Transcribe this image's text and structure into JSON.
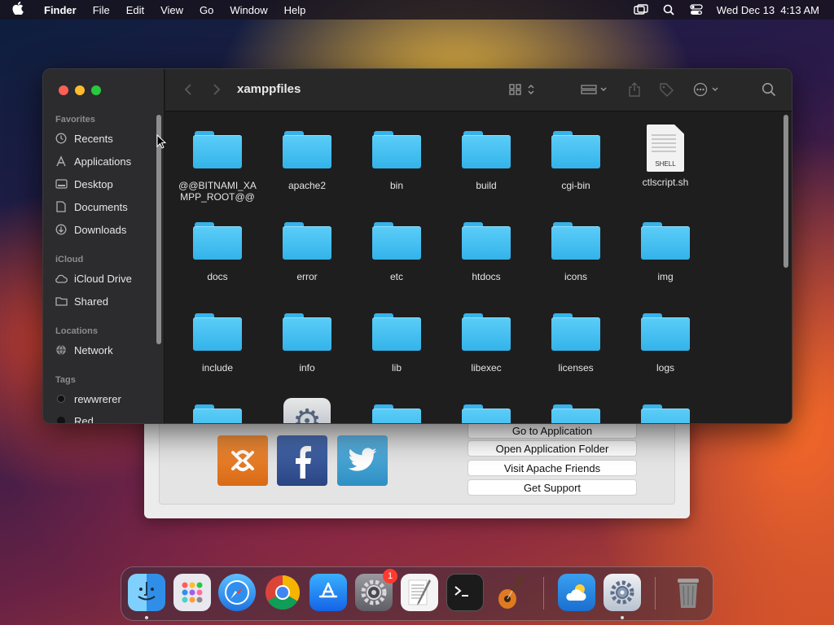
{
  "menubar": {
    "app_name": "Finder",
    "items": [
      "File",
      "Edit",
      "View",
      "Go",
      "Window",
      "Help"
    ],
    "datetime": "Wed Dec 13  4:13 AM"
  },
  "finder": {
    "title": "xamppfiles",
    "sidebar": {
      "favorites_header": "Favorites",
      "favorites": [
        {
          "label": "Recents",
          "icon": "clock-icon"
        },
        {
          "label": "Applications",
          "icon": "applications-icon"
        },
        {
          "label": "Desktop",
          "icon": "desktop-icon"
        },
        {
          "label": "Documents",
          "icon": "document-icon"
        },
        {
          "label": "Downloads",
          "icon": "download-icon"
        }
      ],
      "icloud_header": "iCloud",
      "icloud": [
        {
          "label": "iCloud Drive",
          "icon": "cloud-icon"
        },
        {
          "label": "Shared",
          "icon": "shared-folder-icon"
        }
      ],
      "locations_header": "Locations",
      "locations": [
        {
          "label": "Network",
          "icon": "globe-icon"
        }
      ],
      "tags_header": "Tags",
      "tags": [
        {
          "label": "rewwrerer",
          "color": "#1a1a1a"
        },
        {
          "label": "Red",
          "color": "#ff453a"
        }
      ]
    },
    "items": [
      {
        "label": "@@BITNAMI_XAMPP_ROOT@@",
        "kind": "folder"
      },
      {
        "label": "apache2",
        "kind": "folder"
      },
      {
        "label": "bin",
        "kind": "folder"
      },
      {
        "label": "build",
        "kind": "folder"
      },
      {
        "label": "cgi-bin",
        "kind": "folder"
      },
      {
        "label": "ctlscript.sh",
        "kind": "shell",
        "badge": "SHELL"
      },
      {
        "label": "docs",
        "kind": "folder"
      },
      {
        "label": "error",
        "kind": "folder"
      },
      {
        "label": "etc",
        "kind": "folder"
      },
      {
        "label": "htdocs",
        "kind": "folder"
      },
      {
        "label": "icons",
        "kind": "folder"
      },
      {
        "label": "img",
        "kind": "folder"
      },
      {
        "label": "include",
        "kind": "folder"
      },
      {
        "label": "info",
        "kind": "folder"
      },
      {
        "label": "lib",
        "kind": "folder"
      },
      {
        "label": "libexec",
        "kind": "folder"
      },
      {
        "label": "licenses",
        "kind": "folder"
      },
      {
        "label": "logs",
        "kind": "folder"
      }
    ]
  },
  "xampp": {
    "buttons": [
      "Go to Application",
      "Open Application Folder",
      "Visit Apache Friends",
      "Get Support"
    ]
  },
  "dock": {
    "apps": [
      {
        "name": "finder-icon",
        "color": "#3aa0f0"
      },
      {
        "name": "launchpad-icon",
        "color": "#e8e8ee"
      },
      {
        "name": "safari-icon",
        "color": "#2f8ff0"
      },
      {
        "name": "chrome-icon",
        "color": "#ffffff"
      },
      {
        "name": "app-store-icon",
        "color": "#1d8af5"
      },
      {
        "name": "system-settings-icon",
        "color": "#8a8a8e"
      },
      {
        "name": "textedit-icon",
        "color": "#f2f2f2"
      },
      {
        "name": "terminal-icon",
        "color": "#1b1b1b"
      },
      {
        "name": "garageband-icon",
        "color": "#2a2a2a"
      },
      {
        "name": "weather-icon",
        "color": "#3a8fe0"
      },
      {
        "name": "xampp-manager-icon",
        "color": "#d6dbe3"
      },
      {
        "name": "trash-icon",
        "color": "#6a6a6a"
      }
    ],
    "settings_badge": "1"
  }
}
